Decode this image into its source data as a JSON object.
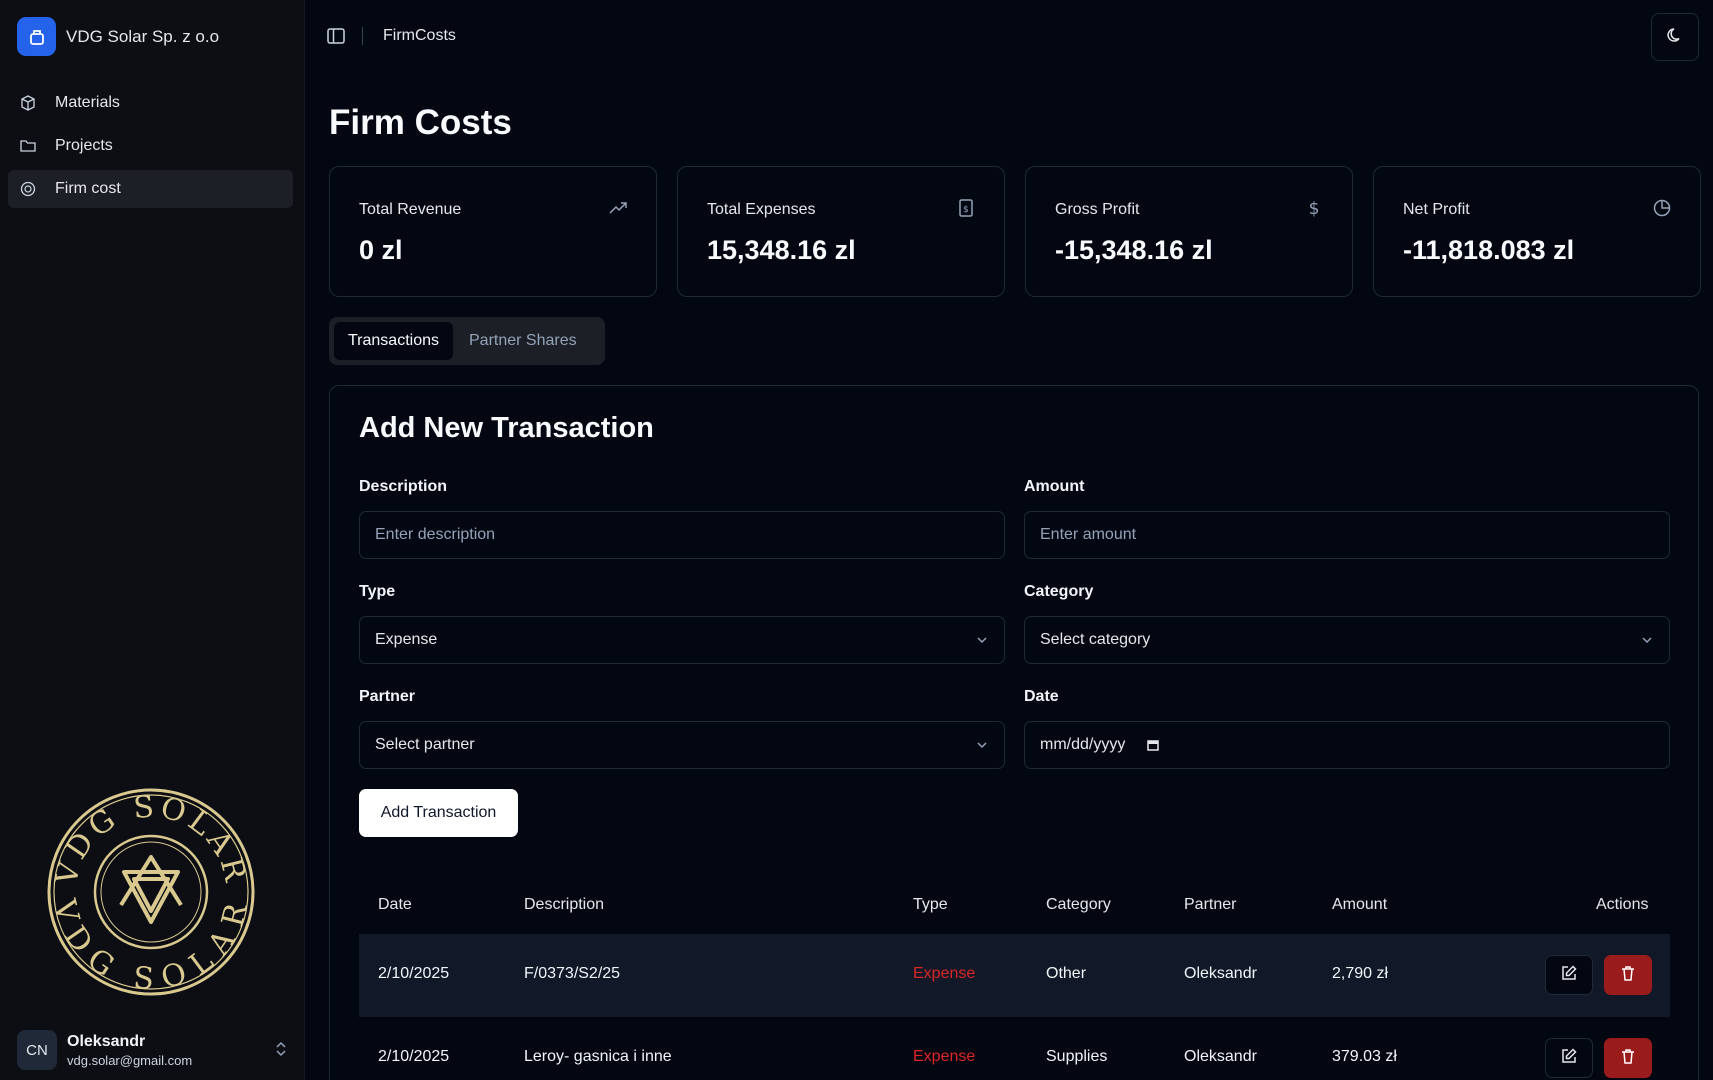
{
  "app": {
    "name": "VDG Solar Sp. z o.o"
  },
  "sidebar": {
    "items": [
      {
        "label": "Materials",
        "icon": "box-icon"
      },
      {
        "label": "Projects",
        "icon": "folder-icon"
      },
      {
        "label": "Firm cost",
        "icon": "coin-icon",
        "active": true
      }
    ],
    "seal_text": "VDG SOLAR",
    "user": {
      "initials": "CN",
      "name": "Oleksandr",
      "email": "vdg.solar@gmail.com"
    }
  },
  "topbar": {
    "breadcrumb": "FirmCosts"
  },
  "page": {
    "title": "Firm Costs"
  },
  "cards": [
    {
      "label": "Total Revenue",
      "value": "0 zl",
      "icon": "trending-up-icon"
    },
    {
      "label": "Total Expenses",
      "value": "15,348.16 zl",
      "icon": "receipt-icon"
    },
    {
      "label": "Gross Profit",
      "value": "-15,348.16 zl",
      "icon": "dollar-icon"
    },
    {
      "label": "Net Profit",
      "value": "-11,818.083 zl",
      "icon": "pie-chart-icon"
    }
  ],
  "tabs": [
    {
      "label": "Transactions",
      "active": true
    },
    {
      "label": "Partner Shares",
      "active": false
    }
  ],
  "form": {
    "title": "Add New Transaction",
    "description": {
      "label": "Description",
      "placeholder": "Enter description"
    },
    "amount": {
      "label": "Amount",
      "placeholder": "Enter amount"
    },
    "type": {
      "label": "Type",
      "value": "Expense"
    },
    "category": {
      "label": "Category",
      "value": "Select category"
    },
    "partner": {
      "label": "Partner",
      "value": "Select partner"
    },
    "date": {
      "label": "Date",
      "value": "mm/dd/yyyy"
    },
    "submit": "Add Transaction"
  },
  "table": {
    "headers": [
      "Date",
      "Description",
      "Type",
      "Category",
      "Partner",
      "Amount",
      "Actions"
    ],
    "rows": [
      {
        "date": "2/10/2025",
        "description": "F/0373/S2/25",
        "type": "Expense",
        "category": "Other",
        "partner": "Oleksandr",
        "amount": "2,790 zł"
      },
      {
        "date": "2/10/2025",
        "description": "Leroy- gasnica i inne",
        "type": "Expense",
        "category": "Supplies",
        "partner": "Oleksandr",
        "amount": "379.03 zł"
      }
    ]
  },
  "colors": {
    "accent": "#2563eb",
    "expense": "#dc2626",
    "danger": "#991b1b",
    "seal": "#d9c98f"
  }
}
